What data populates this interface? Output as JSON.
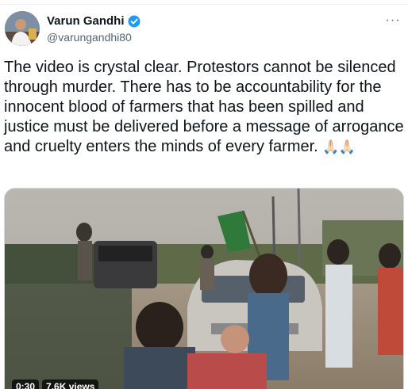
{
  "author": {
    "display_name": "Varun Gandhi",
    "handle": "@varungandhi80",
    "verified": true
  },
  "icons": {
    "verified": "verified-badge-icon",
    "more": "more-horizontal-icon"
  },
  "more_label": "···",
  "tweet": {
    "text": "The video is crystal clear. Protestors cannot be silenced through murder. There has to be accountability for the innocent blood of farmers that has been spilled and justice must be delivered before a message of arrogance and cruelty enters the minds of every farmer.",
    "emoji": "🙏🏻🙏🏻"
  },
  "video": {
    "duration": "0:30",
    "views": "7.6K views"
  },
  "colors": {
    "verified_blue": "#1d9bf0",
    "text": "#0f1419",
    "secondary_text": "#536471"
  }
}
